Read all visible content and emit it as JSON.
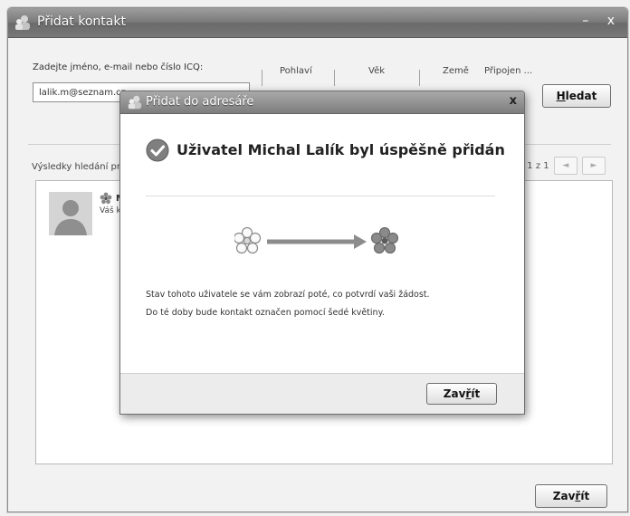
{
  "main_window": {
    "title": "Přidat kontakt",
    "window_buttons": "– x",
    "search_label": "Zadejte jméno, e-mail nebo číslo ICQ:",
    "search_value": "lalik.m@seznam.cz",
    "columns": [
      "Pohlaví",
      "Věk",
      "Země",
      "Připojen ..."
    ],
    "search_button_accel": "H",
    "search_button_rest": "ledat",
    "results_label": "Výsledky hledání pro",
    "pager_text": "1 z 1",
    "pager_prev": "◄",
    "pager_next": "►",
    "result": {
      "name_partial": "M",
      "sub_partial": "Váš k"
    },
    "close_button_pre": "Zav",
    "close_button_accel": "ř",
    "close_button_post": "ít"
  },
  "dialog": {
    "title": "Přidat do adresáře",
    "close": "x",
    "heading": "Uživatel Michal Lalík byl úspěšně přidán",
    "line1": "Stav tohoto uživatele se vám zobrazí poté, co potvrdí vaši žádost.",
    "line2": "Do té doby bude kontakt označen pomocí šedé květiny.",
    "close_button_pre": "Zav",
    "close_button_accel": "ř",
    "close_button_post": "ít"
  },
  "icons": {
    "title": "contacts-icon",
    "check": "check-circle-icon",
    "flower_gray": "gray-flower-icon",
    "flower_colored": "colored-flower-icon",
    "arrow": "arrow-right-icon"
  }
}
